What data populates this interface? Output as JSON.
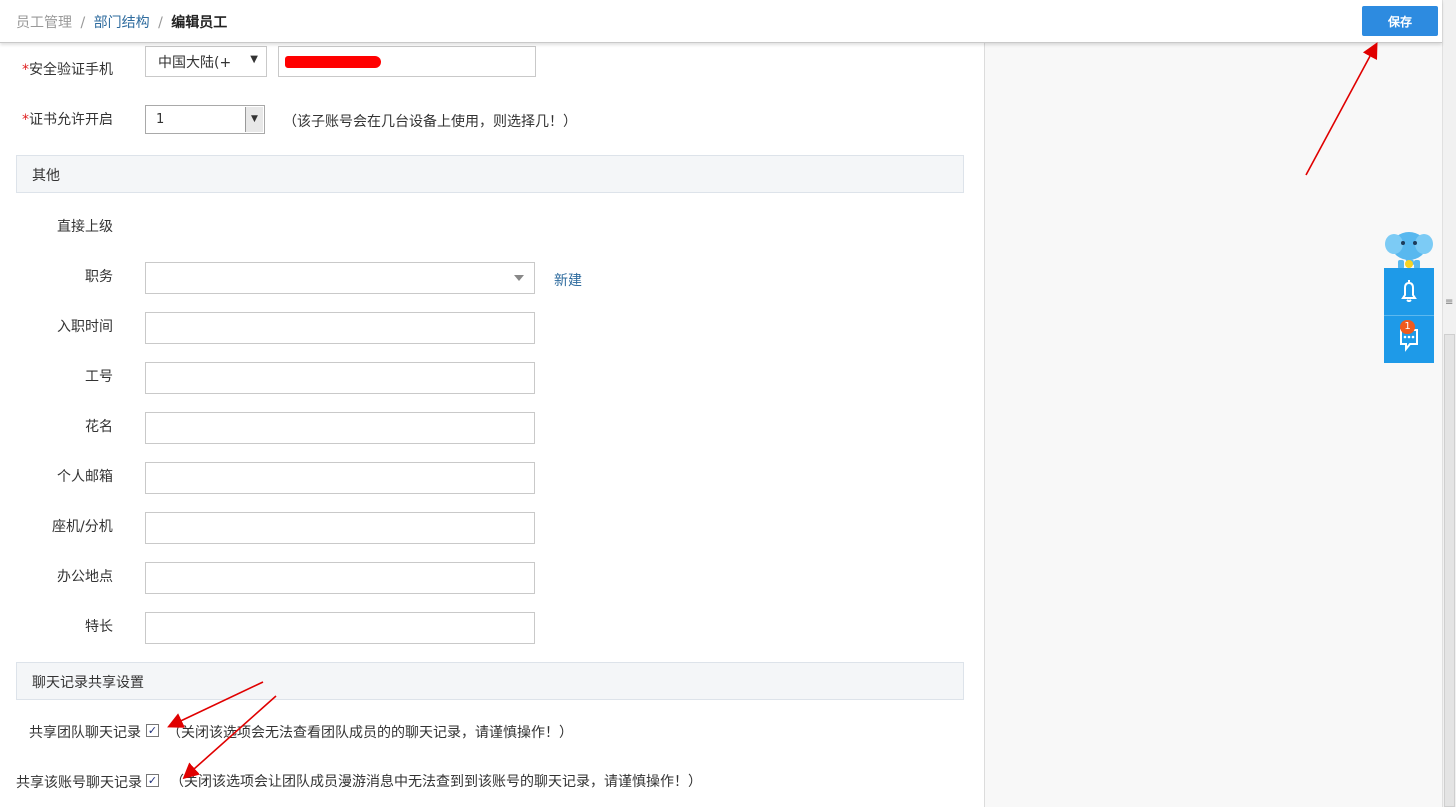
{
  "breadcrumb": {
    "root": "员工管理",
    "sep": "/",
    "parent": "部门结构",
    "current": "编辑员工"
  },
  "toolbar": {
    "save_label": "保存"
  },
  "security": {
    "required_mark": "*",
    "phone_label": "安全验证手机",
    "country_code": "中国大陆(+",
    "country_caret": "▼",
    "cert_label": "证书允许开启",
    "cert_value": "1",
    "cert_hint": "（该子账号会在几台设备上使用，则选择几！）"
  },
  "other": {
    "section_title": "其他",
    "supervisor_label": "直接上级",
    "position_label": "职务",
    "new_link": "新建",
    "hire_date_label": "入职时间",
    "employee_no_label": "工号",
    "nickname_label": "花名",
    "email_label": "个人邮箱",
    "landline_label": "座机/分机",
    "office_label": "办公地点",
    "specialty_label": "特长"
  },
  "chat": {
    "section_title": "聊天记录共享设置",
    "team_share_label": "共享团队聊天记录",
    "team_share_checked": true,
    "team_share_hint": "（关闭该选项会无法查看团队成员的的聊天记录，请谨慎操作！）",
    "account_share_label": "共享该账号聊天记录",
    "account_share_checked": true,
    "account_share_hint": "（关闭该选项会让团队成员漫游消息中无法查到到该账号的聊天记录，请谨慎操作！）",
    "check_glyph": "✓"
  },
  "sidebar": {
    "notification_badge": "1",
    "mascot_icon": "elephant-mascot-icon",
    "bell_icon": "bell-icon",
    "chat_icon": "chat-bubble-icon"
  },
  "colors": {
    "accent": "#2d8be0",
    "link": "#2e6b9e",
    "required": "#e02020",
    "annotation_arrow": "#e00000",
    "side_widget": "#1e9ae8"
  },
  "scrollbar": {
    "grip_icon": "scroll-grip-icon",
    "grip_glyph": "≡"
  }
}
